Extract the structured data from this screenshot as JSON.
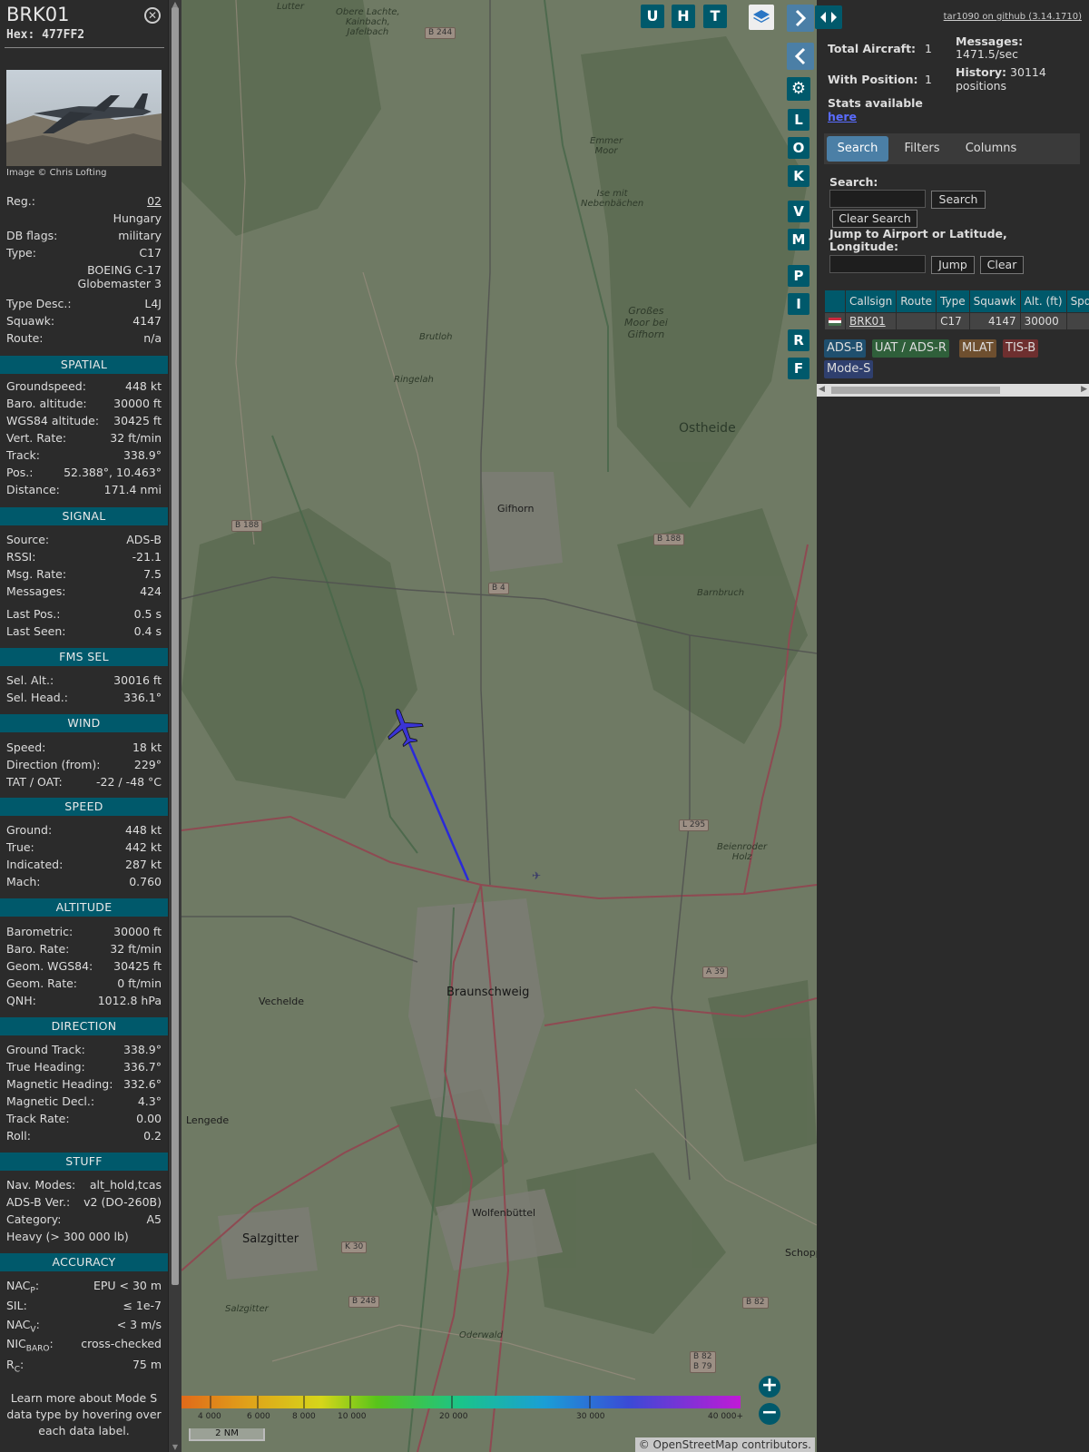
{
  "info": {
    "callsign": "BRK01",
    "hex_label": "Hex:",
    "hex": "477FF2",
    "image_credit": "Image © Chris Lofting",
    "reg_label": "Reg.:",
    "reg": "02",
    "country": "Hungary",
    "dbflags_label": "DB flags:",
    "dbflags": "military",
    "type_label": "Type:",
    "type": "C17",
    "type_name_1": "BOEING C-17",
    "type_name_2": "Globemaster 3",
    "typedesc_label": "Type Desc.:",
    "typedesc": "L4J",
    "squawk_label": "Squawk:",
    "squawk": "4147",
    "route_label": "Route:",
    "route": "n/a",
    "sections": {
      "spatial": "SPATIAL",
      "signal": "SIGNAL",
      "fms": "FMS SEL",
      "wind": "WIND",
      "speed": "SPEED",
      "altitude": "ALTITUDE",
      "direction": "DIRECTION",
      "stuff": "STUFF",
      "accuracy": "ACCURACY"
    },
    "spatial": [
      {
        "label": "Groundspeed:",
        "value": "448 kt"
      },
      {
        "label": "Baro. altitude:",
        "value": "30000 ft"
      },
      {
        "label": "WGS84 altitude:",
        "value": "30425 ft"
      },
      {
        "label": "Vert. Rate:",
        "value": "32 ft/min"
      },
      {
        "label": "Track:",
        "value": "338.9°"
      },
      {
        "label": "Pos.:",
        "value": "52.388°, 10.463°"
      },
      {
        "label": "Distance:",
        "value": "171.4 nmi"
      }
    ],
    "signal": [
      {
        "label": "Source:",
        "value": "ADS-B"
      },
      {
        "label": "RSSI:",
        "value": "-21.1"
      },
      {
        "label": "Msg. Rate:",
        "value": "7.5"
      },
      {
        "label": "Messages:",
        "value": "424"
      },
      {
        "label": "Last Pos.:",
        "value": "0.5 s"
      },
      {
        "label": "Last Seen:",
        "value": "0.4 s"
      }
    ],
    "fms": [
      {
        "label": "Sel. Alt.:",
        "value": "30016 ft"
      },
      {
        "label": "Sel. Head.:",
        "value": "336.1°"
      }
    ],
    "wind": [
      {
        "label": "Speed:",
        "value": "18 kt"
      },
      {
        "label": "Direction (from):",
        "value": "229°"
      },
      {
        "label": "TAT / OAT:",
        "value": "-22 / -48 °C"
      }
    ],
    "speed": [
      {
        "label": "Ground:",
        "value": "448 kt"
      },
      {
        "label": "True:",
        "value": "442 kt"
      },
      {
        "label": "Indicated:",
        "value": "287 kt"
      },
      {
        "label": "Mach:",
        "value": "0.760"
      }
    ],
    "altitude": [
      {
        "label": "Barometric:",
        "value": "30000 ft"
      },
      {
        "label": "Baro. Rate:",
        "value": "32 ft/min"
      },
      {
        "label": "Geom. WGS84:",
        "value": "30425 ft"
      },
      {
        "label": "Geom. Rate:",
        "value": "0 ft/min"
      },
      {
        "label": "QNH:",
        "value": "1012.8 hPa"
      }
    ],
    "direction": [
      {
        "label": "Ground Track:",
        "value": "338.9°"
      },
      {
        "label": "True Heading:",
        "value": "336.7°"
      },
      {
        "label": "Magnetic Heading:",
        "value": "332.6°"
      },
      {
        "label": "Magnetic Decl.:",
        "value": "4.3°"
      },
      {
        "label": "Track Rate:",
        "value": "0.00"
      },
      {
        "label": "Roll:",
        "value": "0.2"
      }
    ],
    "stuff": [
      {
        "label": "Nav. Modes:",
        "value": "alt_hold,tcas"
      },
      {
        "label": "ADS-B Ver.:",
        "value": "v2 (DO-260B)"
      },
      {
        "label": "Category:",
        "value": "A5"
      },
      {
        "label": "Heavy (> 300 000 lb)",
        "value": ""
      }
    ],
    "accuracy": {
      "nacp_label": "NAC",
      "nacp_sub": "P",
      "nacp": "EPU < 30 m",
      "sil_label": "SIL:",
      "sil": "≤ 1e-7",
      "nacv_label": "NAC",
      "nacv_sub": "V",
      "nacv": "< 3 m/s",
      "nicbaro_label": "NIC",
      "nicbaro_sub": "BARO",
      "nicbaro": "cross-checked",
      "rc_label": "R",
      "rc_sub": "C",
      "rc": "75 m"
    },
    "learn_more": "Learn more about Mode S data type by hovering over each data label."
  },
  "map": {
    "buttons_top": [
      "U",
      "H",
      "T"
    ],
    "buttons_side": [
      "L",
      "O",
      "K",
      "V",
      "M",
      "P",
      "I",
      "R",
      "F"
    ],
    "place_labels": {
      "obere_lachte": "Obere Lachte,\nKainbach,\nJafelbach",
      "lutter": "Lutter",
      "emmer": "Emmer\nMoor",
      "ise": "Ise mit\nNebenbächen",
      "grosses": "Großes\nMoor bei\nGifhorn",
      "brutloh": "Brutloh",
      "ringelah": "Ringelah",
      "ostheide": "Ostheide",
      "barnbruch": "Barnbruch",
      "beienroder": "Beienroder\nHolz",
      "oderwald": "Oderwald",
      "salzgitter_small": "Salzgitter"
    },
    "cities": {
      "gifhorn": "Gifhorn",
      "braunschweig": "Braunschweig",
      "vechelde": "Vechelde",
      "lengede": "Lengede",
      "salzgitter": "Salzgitter",
      "wolfenbuttel": "Wolfenbüttel",
      "schopp": "Schopp"
    },
    "roads": [
      "B 244",
      "B 188",
      "B 188",
      "B 4",
      "L 295",
      "A 39",
      "K 30",
      "B 248",
      "B 82",
      "B 82\nB 79"
    ],
    "altitude_ticks": [
      "4 000",
      "6 000",
      "8 000",
      "10 000",
      "20 000",
      "30 000",
      "40 000+"
    ],
    "scale": "2 NM",
    "attribution": "© OpenStreetMap contributors."
  },
  "right": {
    "github_link": "tar1090 on github (3.14.1710)",
    "total_aircraft_label": "Total Aircraft:",
    "total_aircraft": "1",
    "with_position_label": "With Position:",
    "with_position": "1",
    "messages_label": "Messages:",
    "messages_rate": "1471.5/sec",
    "history_label": "History:",
    "history_value": "30114",
    "history_unit": "positions",
    "stats_label": "Stats available",
    "stats_link": "here",
    "tabs": [
      "Search",
      "Filters",
      "Columns"
    ],
    "search_label": "Search:",
    "search_button": "Search",
    "clear_search_button": "Clear Search",
    "jump_label": "Jump to Airport or Latitude, Longitude:",
    "jump_button": "Jump",
    "clear_button": "Clear",
    "table": {
      "headers": [
        "",
        "Callsign",
        "Route",
        "Type",
        "Squawk",
        "Alt. (ft)",
        "Spd."
      ],
      "rows": [
        {
          "callsign": "BRK01",
          "route": "",
          "type": "C17",
          "squawk": "4147",
          "alt": "30000",
          "spd": ""
        }
      ]
    },
    "sources": [
      {
        "label": "ADS-B",
        "color": "#1f4f6e"
      },
      {
        "label": "UAT / ADS-R",
        "color": "#2f5f3a"
      },
      {
        "label": "MLAT",
        "color": "#6e4f2f"
      },
      {
        "label": "TIS-B",
        "color": "#6e2f2f"
      },
      {
        "label": "Mode-S",
        "color": "#2f3f6e"
      }
    ]
  }
}
